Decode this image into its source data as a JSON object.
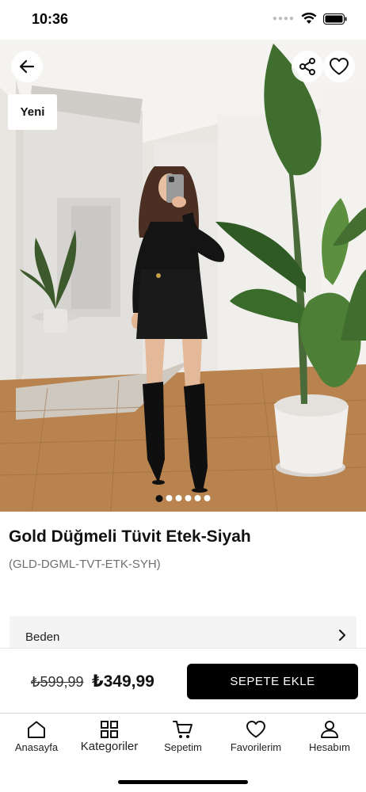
{
  "status_bar": {
    "time": "10:36",
    "signal_icon": "signal-dots-icon",
    "wifi_icon": "wifi-icon",
    "battery_icon": "battery-icon"
  },
  "product": {
    "badge": "Yeni",
    "title": "Gold Düğmeli Tüvit Etek-Siyah",
    "code": "(GLD-DGML-TVT-ETK-SYH)",
    "image_count": 6,
    "active_image_index": 0
  },
  "size": {
    "label": "Beden"
  },
  "pricing": {
    "old_price": "₺599,99",
    "new_price": "₺349,99",
    "add_to_cart": "SEPETE EKLE"
  },
  "tabs": [
    {
      "label": "Anasayfa",
      "icon": "home-icon"
    },
    {
      "label": "Kategoriler",
      "icon": "grid-icon"
    },
    {
      "label": "Sepetim",
      "icon": "cart-icon"
    },
    {
      "label": "Favorilerim",
      "icon": "heart-icon"
    },
    {
      "label": "Hesabım",
      "icon": "user-icon"
    }
  ]
}
